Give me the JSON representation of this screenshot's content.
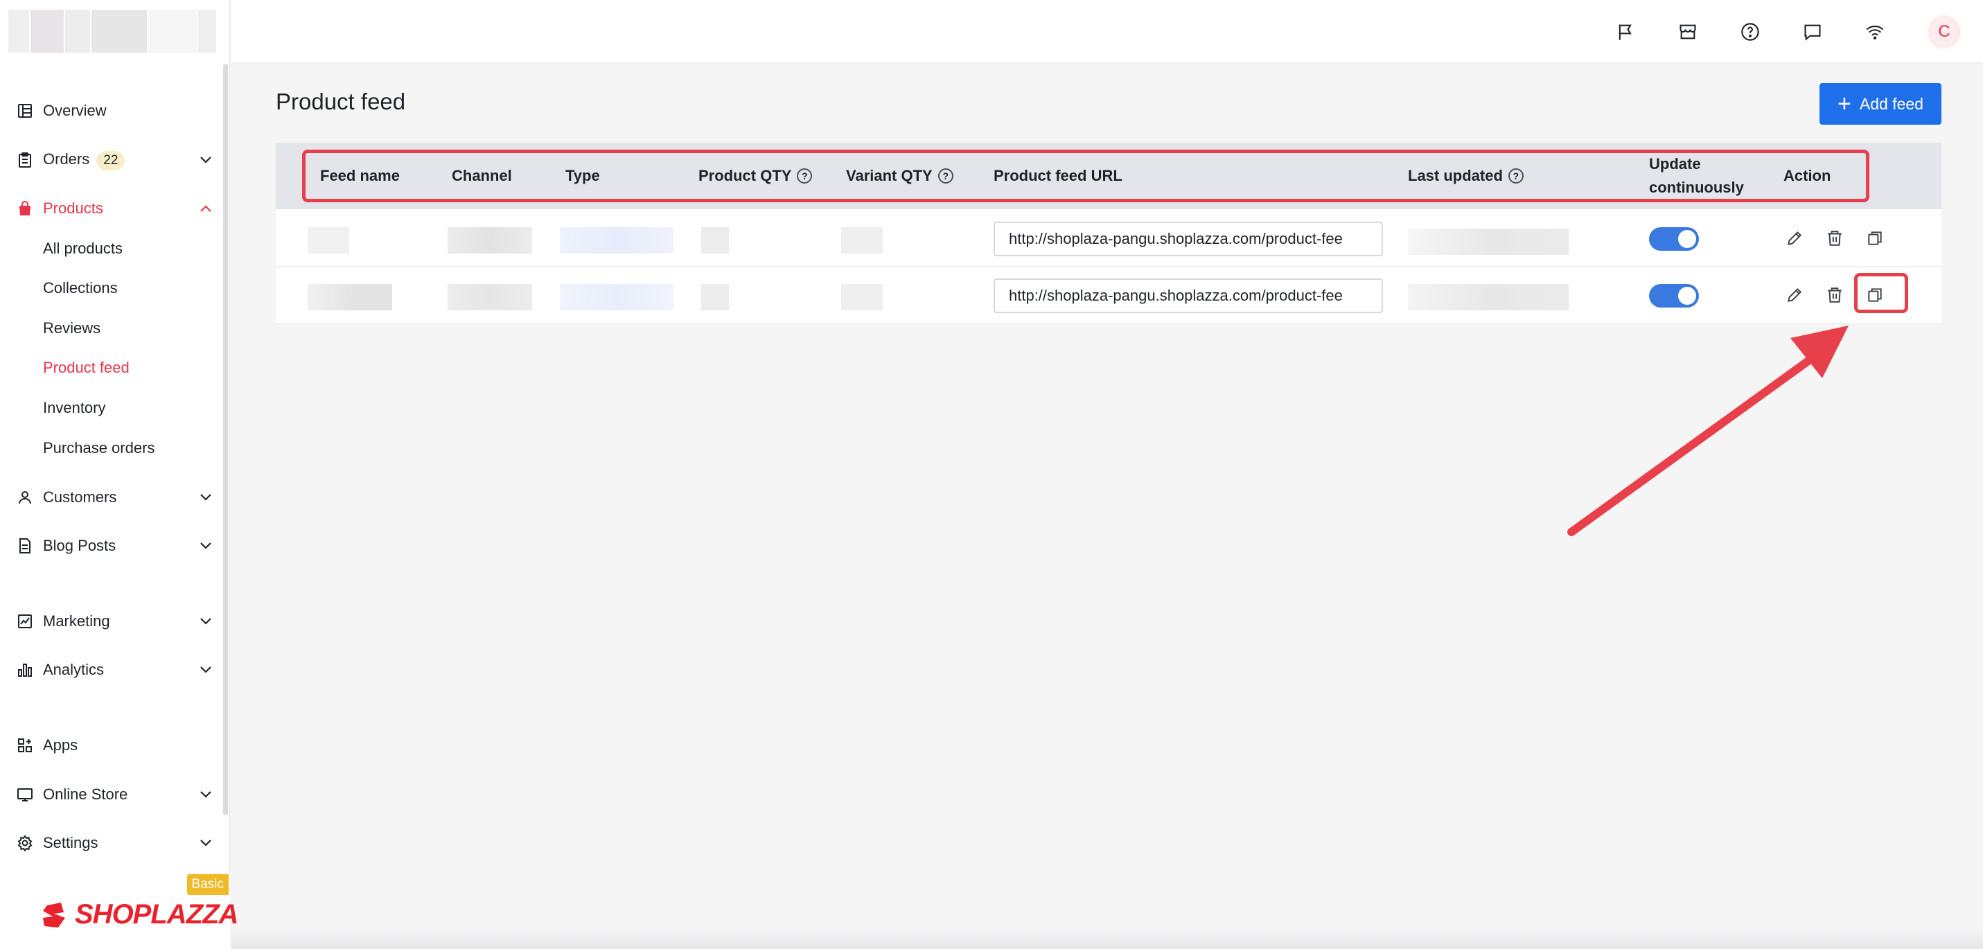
{
  "sidebar": {
    "nav": [
      {
        "label": "Overview",
        "icon": "overview-icon",
        "expandable": false,
        "active": false
      },
      {
        "label": "Orders",
        "icon": "orders-icon",
        "badge": "22",
        "expandable": true,
        "active": false
      },
      {
        "label": "Products",
        "icon": "products-bag-icon",
        "expandable": true,
        "active": true,
        "expanded": true
      },
      {
        "label": "Customers",
        "icon": "customers-icon",
        "expandable": true
      },
      {
        "label": "Blog Posts",
        "icon": "blog-posts-icon",
        "expandable": true
      },
      {
        "label": "Marketing",
        "icon": "marketing-icon",
        "expandable": true
      },
      {
        "label": "Analytics",
        "icon": "analytics-icon",
        "expandable": true
      },
      {
        "label": "Apps",
        "icon": "apps-icon",
        "expandable": false
      },
      {
        "label": "Online Store",
        "icon": "online-store-icon",
        "expandable": true
      },
      {
        "label": "Settings",
        "icon": "settings-icon",
        "expandable": true
      }
    ],
    "products_sub": [
      {
        "label": "All products",
        "active": false
      },
      {
        "label": "Collections",
        "active": false
      },
      {
        "label": "Reviews",
        "active": false
      },
      {
        "label": "Product feed",
        "active": true
      },
      {
        "label": "Inventory",
        "active": false
      },
      {
        "label": "Purchase orders",
        "active": false
      }
    ],
    "plan_badge": "Basic",
    "brand": "SHOPLAZZA"
  },
  "topbar": {
    "icons": [
      "flag-icon",
      "store-icon",
      "help-icon",
      "chat-icon",
      "wifi-icon"
    ],
    "avatar_initial": "C"
  },
  "page": {
    "title": "Product feed",
    "add_button": "Add feed"
  },
  "table": {
    "columns": [
      "Feed name",
      "Channel",
      "Type",
      "Product QTY",
      "Variant QTY",
      "Product feed URL",
      "Last updated",
      "Update continuously",
      "Action"
    ],
    "rows": [
      {
        "url": "http://shoplaza-pangu.shoplazza.com/product-fee",
        "update_continuously": true
      },
      {
        "url": "http://shoplaza-pangu.shoplazza.com/product-fee",
        "update_continuously": true
      }
    ]
  },
  "colors": {
    "accent_red": "#e8344a",
    "primary_blue": "#1f6feb",
    "toggle_blue": "#3a7ae0",
    "annotation_red": "#e8404a"
  }
}
